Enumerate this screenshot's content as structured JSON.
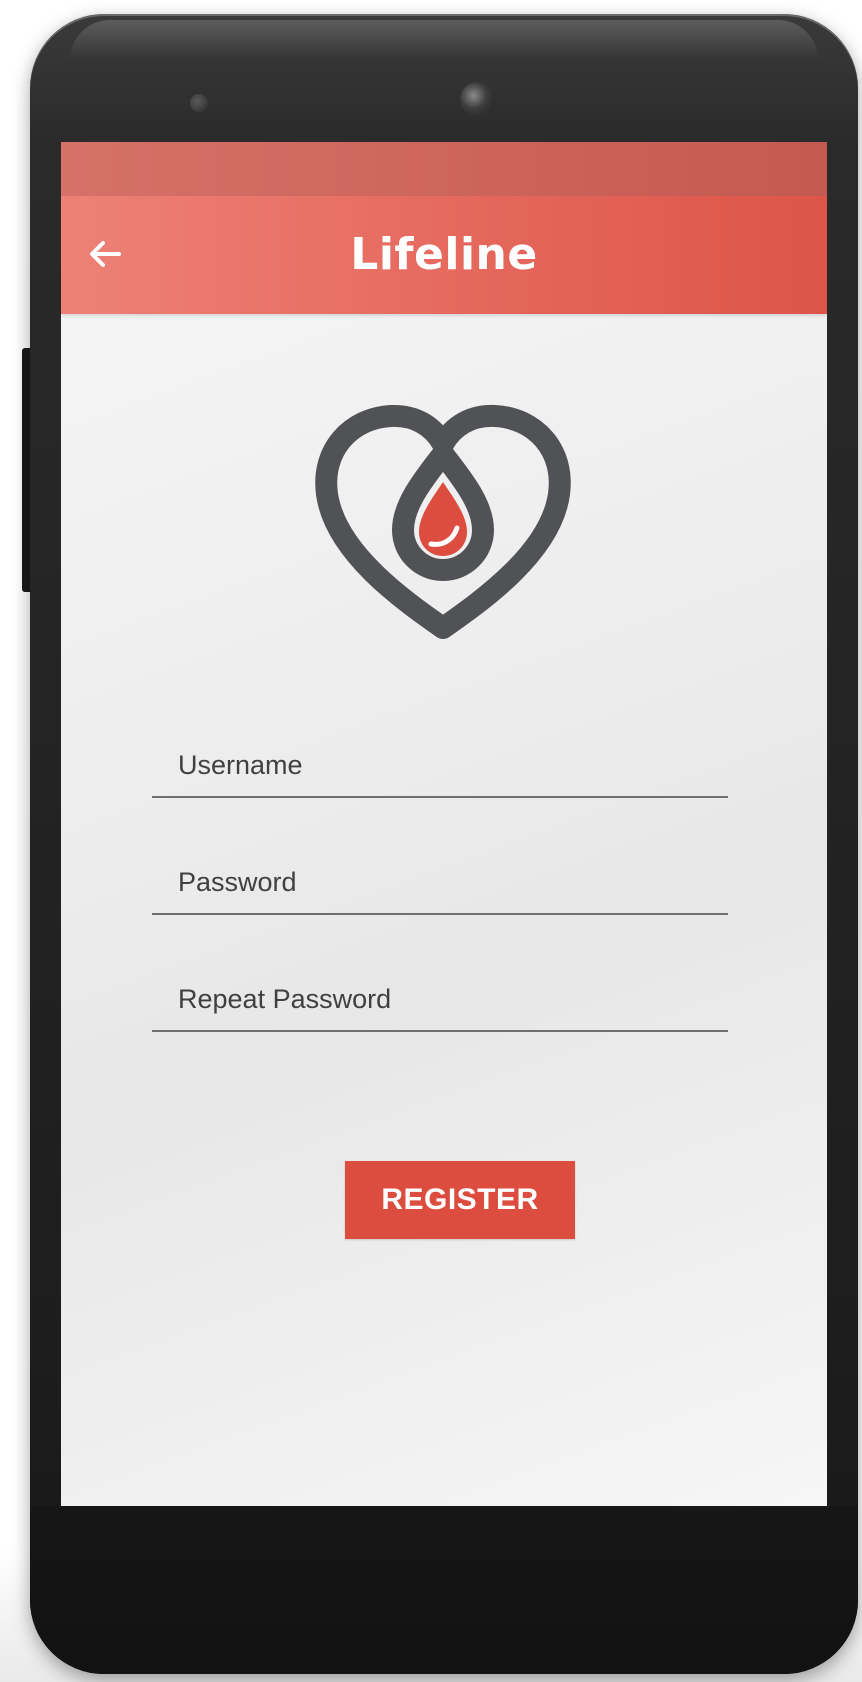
{
  "app": {
    "title": "Lifeline"
  },
  "navigation": {
    "back_icon": "arrow-left-icon"
  },
  "logo": {
    "icon": "heart-blood-drop-logo",
    "outline_color": "#505256",
    "drop_color": "#dc4c3f"
  },
  "form": {
    "username_placeholder": "Username",
    "password_placeholder": "Password",
    "repeat_password_placeholder": "Repeat Password",
    "register_label": "REGISTER"
  },
  "colors": {
    "app_bar": "#e4655a",
    "status_bar": "#c45a51",
    "button": "#dc4c3f",
    "screen_background": "#ececec"
  }
}
